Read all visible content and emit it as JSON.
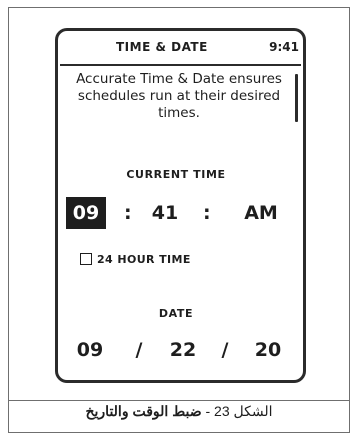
{
  "screen": {
    "title": "TIME & DATE",
    "clock": "9:41",
    "description": "Accurate Time & Date ensures schedules run at their desired times."
  },
  "current_time": {
    "label": "CURRENT TIME",
    "hour": "09",
    "minute": "41",
    "period": "AM",
    "separator": ":"
  },
  "options": {
    "hour24_label": "24 HOUR TIME",
    "hour24_checked": false
  },
  "date": {
    "label": "DATE",
    "month": "09",
    "day": "22",
    "year": "20",
    "separator": "/"
  },
  "caption": {
    "prefix": "الشكل 23 -",
    "title": "ضبط الوقت والتاريخ"
  }
}
